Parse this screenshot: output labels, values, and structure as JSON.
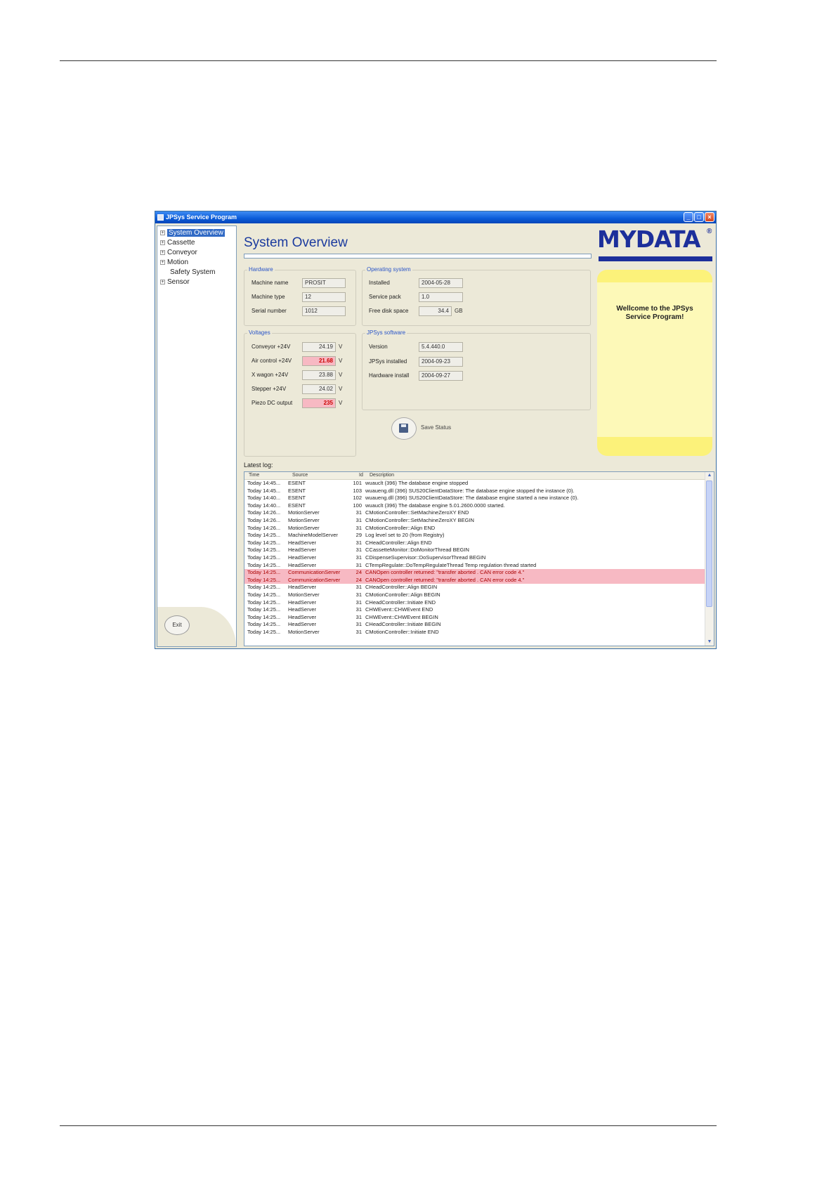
{
  "window": {
    "title": "JPSys Service Program",
    "minimize": "_",
    "maximize": "□",
    "close": "×"
  },
  "tree": {
    "items": [
      {
        "label": "System Overview",
        "expander": "+"
      },
      {
        "label": "Cassette",
        "expander": "+"
      },
      {
        "label": "Conveyor",
        "expander": "+"
      },
      {
        "label": "Motion",
        "expander": "+"
      },
      {
        "label": "Safety System",
        "expander": ""
      },
      {
        "label": "Sensor",
        "expander": "+"
      }
    ],
    "exit_label": "Exit"
  },
  "main": {
    "title": "System Overview"
  },
  "logo": {
    "text": "MYDATA",
    "mark": "®"
  },
  "welcome": {
    "line1": "Wellcome to the JPSys",
    "line2": "Service Program!"
  },
  "hardware": {
    "title": "Hardware",
    "machine_name_label": "Machine name",
    "machine_name": "PROSIT",
    "machine_type_label": "Machine type",
    "machine_type": "12",
    "serial_number_label": "Serial number",
    "serial_number": "1012"
  },
  "operating_system": {
    "title": "Operating system",
    "installed_label": "Installed",
    "installed": "2004-05-28",
    "service_pack_label": "Service pack",
    "service_pack": "1.0",
    "free_disk_label": "Free disk space",
    "free_disk": "34.4",
    "free_disk_unit": "GB"
  },
  "voltages": {
    "title": "Voltages",
    "rows": [
      {
        "label": "Conveyor +24V",
        "value": "24.19",
        "unit": "V",
        "alert": false
      },
      {
        "label": "Air control +24V",
        "value": "21.68",
        "unit": "V",
        "alert": true
      },
      {
        "label": "X wagon +24V",
        "value": "23.88",
        "unit": "V",
        "alert": false
      },
      {
        "label": "Stepper +24V",
        "value": "24.02",
        "unit": "V",
        "alert": false
      },
      {
        "label": "Piezo DC output",
        "value": "235",
        "unit": "V",
        "alert": true
      }
    ],
    "alert_color": "#f7b9c3"
  },
  "jpsys_software": {
    "title": "JPSys software",
    "version_label": "Version",
    "version": "5.4.440.0",
    "installed_label": "JPSys installed",
    "installed": "2004-09-23",
    "hw_install_label": "Hardware install",
    "hw_install": "2004-09-27"
  },
  "save": {
    "label": "Save Status"
  },
  "log": {
    "label": "Latest log:",
    "columns": {
      "time": "Time",
      "source": "Source",
      "id": "Id",
      "description": "Description"
    },
    "rows": [
      {
        "time": "Today   14:45...",
        "source": "ESENT",
        "id": "101",
        "desc": "wuauclt (396) The database engine stopped",
        "error": false
      },
      {
        "time": "Today   14:45...",
        "source": "ESENT",
        "id": "103",
        "desc": "wuaueng.dll (396) SUS20ClientDataStore: The database engine stopped the instance (0).",
        "error": false
      },
      {
        "time": "Today   14:40...",
        "source": "ESENT",
        "id": "102",
        "desc": "wuaueng.dll (396) SUS20ClientDataStore: The database engine started a new instance (0).",
        "error": false
      },
      {
        "time": "Today   14:40...",
        "source": "ESENT",
        "id": "100",
        "desc": "wuauclt (396) The database engine 5.01.2600.0000 started.",
        "error": false
      },
      {
        "time": "Today   14:26...",
        "source": "MotionServer",
        "id": "31",
        "desc": "CMotionController::SetMachineZeroXY   END",
        "error": false
      },
      {
        "time": "Today   14:26...",
        "source": "MotionServer",
        "id": "31",
        "desc": "CMotionController::SetMachineZeroXY   BEGIN",
        "error": false
      },
      {
        "time": "Today   14:26...",
        "source": "MotionServer",
        "id": "31",
        "desc": "CMotionController::Align   END",
        "error": false
      },
      {
        "time": "Today   14:25...",
        "source": "MachineModelServer",
        "id": "29",
        "desc": "Log level set to 20 (from Registry)",
        "error": false
      },
      {
        "time": "Today   14:25...",
        "source": "HeadServer",
        "id": "31",
        "desc": "CHeadController::Align   END",
        "error": false
      },
      {
        "time": "Today   14:25...",
        "source": "HeadServer",
        "id": "31",
        "desc": "CCassetteMonitor::DoMonitorThread   BEGIN",
        "error": false
      },
      {
        "time": "Today   14:25...",
        "source": "HeadServer",
        "id": "31",
        "desc": "CDispenseSupervisor::DoSupervisorThread   BEGIN",
        "error": false
      },
      {
        "time": "Today   14:25...",
        "source": "HeadServer",
        "id": "31",
        "desc": "CTempRegulate::DoTempRegulateThread   Temp regulation thread started",
        "error": false
      },
      {
        "time": "Today   14:25...",
        "source": "CommunicationServer",
        "id": "24",
        "desc": "CANOpen controller returned: \"transfer aborted . CAN error code 4.\"",
        "error": true
      },
      {
        "time": "Today   14:25...",
        "source": "CommunicationServer",
        "id": "24",
        "desc": "CANOpen controller returned: \"transfer aborted . CAN error code 4.\"",
        "error": true
      },
      {
        "time": "Today   14:25...",
        "source": "HeadServer",
        "id": "31",
        "desc": "CHeadController::Align   BEGIN",
        "error": false
      },
      {
        "time": "Today   14:25...",
        "source": "MotionServer",
        "id": "31",
        "desc": "CMotionController::Align   BEGIN",
        "error": false
      },
      {
        "time": "Today   14:25...",
        "source": "HeadServer",
        "id": "31",
        "desc": "CHeadController::Initiate   END",
        "error": false
      },
      {
        "time": "Today   14:25...",
        "source": "HeadServer",
        "id": "31",
        "desc": "CHWEvent::CHWEvent   END",
        "error": false
      },
      {
        "time": "Today   14:25...",
        "source": "HeadServer",
        "id": "31",
        "desc": "CHWEvent::CHWEvent   BEGIN",
        "error": false
      },
      {
        "time": "Today   14:25...",
        "source": "HeadServer",
        "id": "31",
        "desc": "CHeadController::Initiate   BEGIN",
        "error": false
      },
      {
        "time": "Today   14:25...",
        "source": "MotionServer",
        "id": "31",
        "desc": "CMotionController::Initiate   END",
        "error": false
      }
    ]
  }
}
